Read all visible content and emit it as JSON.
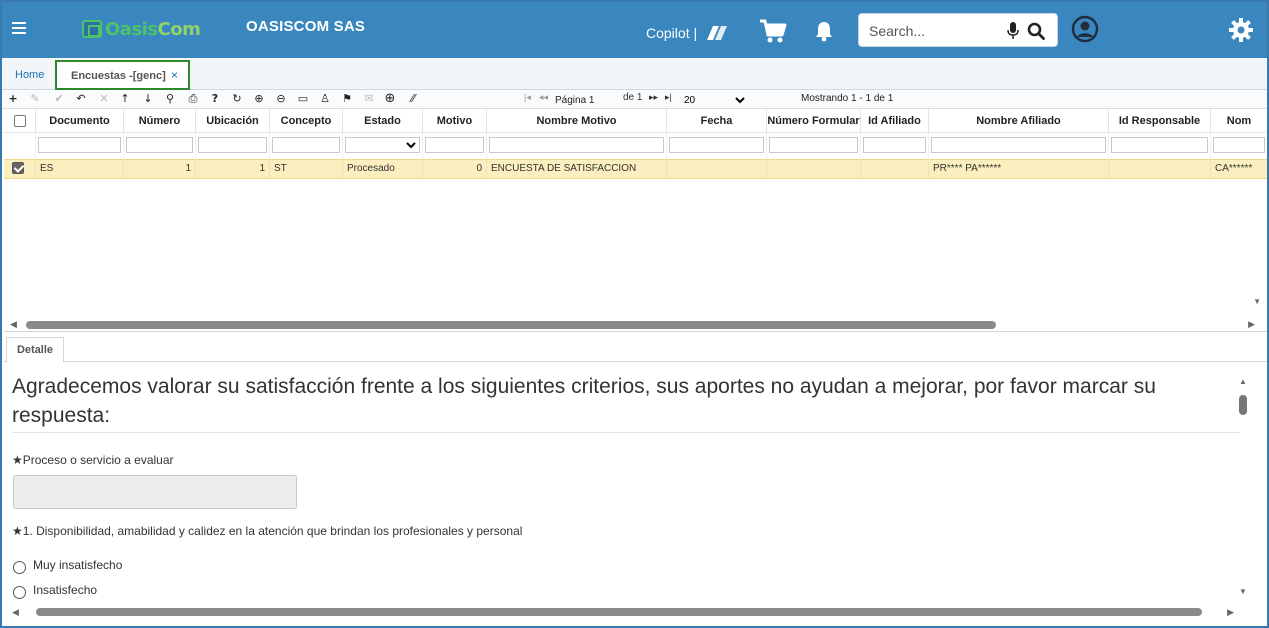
{
  "header": {
    "logo_text_a": "Oasis",
    "logo_text_b": "Com",
    "company": "OASISCOM SAS",
    "copilot_label": "Copilot |",
    "search_placeholder": "Search..."
  },
  "tabs": {
    "home": "Home",
    "active": "Encuestas -[genc]",
    "close": "×"
  },
  "toolbar": {
    "icons": [
      "plus",
      "pencil",
      "check",
      "undo",
      "close",
      "arrow-up",
      "arrow-down",
      "search",
      "print",
      "help",
      "refresh",
      "zoom-in",
      "zoom-out",
      "comment",
      "user",
      "pin",
      "mail",
      "add-circle",
      "resize"
    ],
    "pager_first": "|◂",
    "pager_prev": "◂◂",
    "page_label": "Página 1",
    "page_of": "de 1",
    "pager_next": "▸▸",
    "pager_last": "▸|",
    "page_size": "20",
    "page_size_options": [
      "20"
    ],
    "showing": "Mostrando 1 - 1 de 1"
  },
  "grid": {
    "columns": [
      "Documento",
      "Número",
      "Ubicación",
      "Concepto",
      "Estado",
      "Motivo",
      "Nombre Motivo",
      "Fecha",
      "Número Formular",
      "Id Afiliado",
      "Nombre Afiliado",
      "Id Responsable",
      "Nom"
    ],
    "rows": [
      {
        "documento": "ES",
        "numero": "1",
        "ubicacion": "1",
        "concepto": "ST",
        "estado": "Procesado",
        "motivo": "0",
        "nombre_motivo": "ENCUESTA DE SATISFACCION",
        "fecha": "",
        "numero_formular": "",
        "id_afiliado": "",
        "nombre_afiliado": "PR**** PA******",
        "id_responsable": "",
        "nom": "CA******"
      }
    ]
  },
  "detail": {
    "tab": "Detalle",
    "intro": "Agradecemos valorar su satisfacción frente a los siguientes criterios, sus aportes no ayudan a mejorar, por favor marcar su respuesta:",
    "q0": "★Proceso o servicio a evaluar",
    "q1": "★1. Disponibilidad, amabilidad y calidez en la atención que brindan los profesionales y personal",
    "options": [
      "Muy insatisfecho",
      "Insatisfecho"
    ]
  },
  "colors": {
    "topbar": "#3a86bf",
    "selected_row": "#fbeebf",
    "active_tab_border": "#2c8a2c",
    "link": "#1d6fb0"
  }
}
